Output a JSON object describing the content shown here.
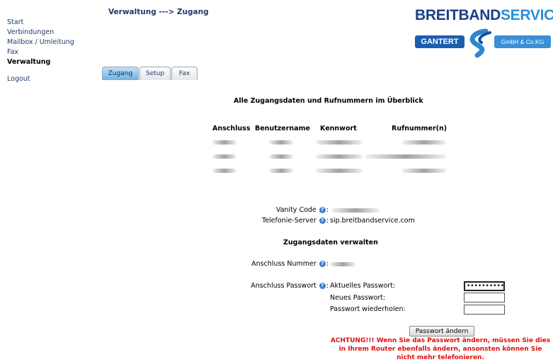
{
  "nav": {
    "items": [
      {
        "label": "Start"
      },
      {
        "label": "Verbindungen"
      },
      {
        "label": "Mailbox / Umleitung"
      },
      {
        "label": "Fax"
      },
      {
        "label": "Verwaltung"
      },
      {
        "label": "Logout"
      }
    ]
  },
  "breadcrumb": "Verwaltung ---> Zugang",
  "logo": {
    "brand_part1": "BREITBAND",
    "brand_part2": "SERVICE",
    "left_text": "GANTERT",
    "right_text": "GmbH & Co.KG"
  },
  "tabs": [
    {
      "label": "Zugang",
      "active": true
    },
    {
      "label": "Setup",
      "active": false
    },
    {
      "label": "Fax",
      "active": false
    }
  ],
  "overview_title": "Alle Zugangsdaten und Rufnummern im Überblick",
  "table": {
    "headers": [
      "Anschluss",
      "Benutzername",
      "Kennwort",
      "Rufnummer(n)"
    ]
  },
  "vanity_code": {
    "label": "Vanity Code"
  },
  "telefonie_server": {
    "label": "Telefonie-Server",
    "value": "sip.breitbandservice.com"
  },
  "manage_title": "Zugangsdaten verwalten",
  "anschluss_nummer": {
    "label": "Anschluss Nummer"
  },
  "anschluss_passwort": {
    "label": "Anschluss Passwort",
    "fields": [
      {
        "label": "Aktuelles Passwort:",
        "value": "••••••••••"
      },
      {
        "label": "Neues Passwort:",
        "value": ""
      },
      {
        "label": "Passwort wiederholen:",
        "value": ""
      }
    ]
  },
  "change_button": "Passwort ändern",
  "warning": "ACHTUNG!!! Wenn Sie das Passwort ändern, müssen Sie dies in Ihrem Router ebenfalls ändern, ansonsten können Sie nicht mehr telefonieren.",
  "colors": {
    "link": "#1f3a6e",
    "warning": "#e01010",
    "tab_active": "#6fb2e2"
  },
  "icons": {
    "help": "help-icon"
  }
}
